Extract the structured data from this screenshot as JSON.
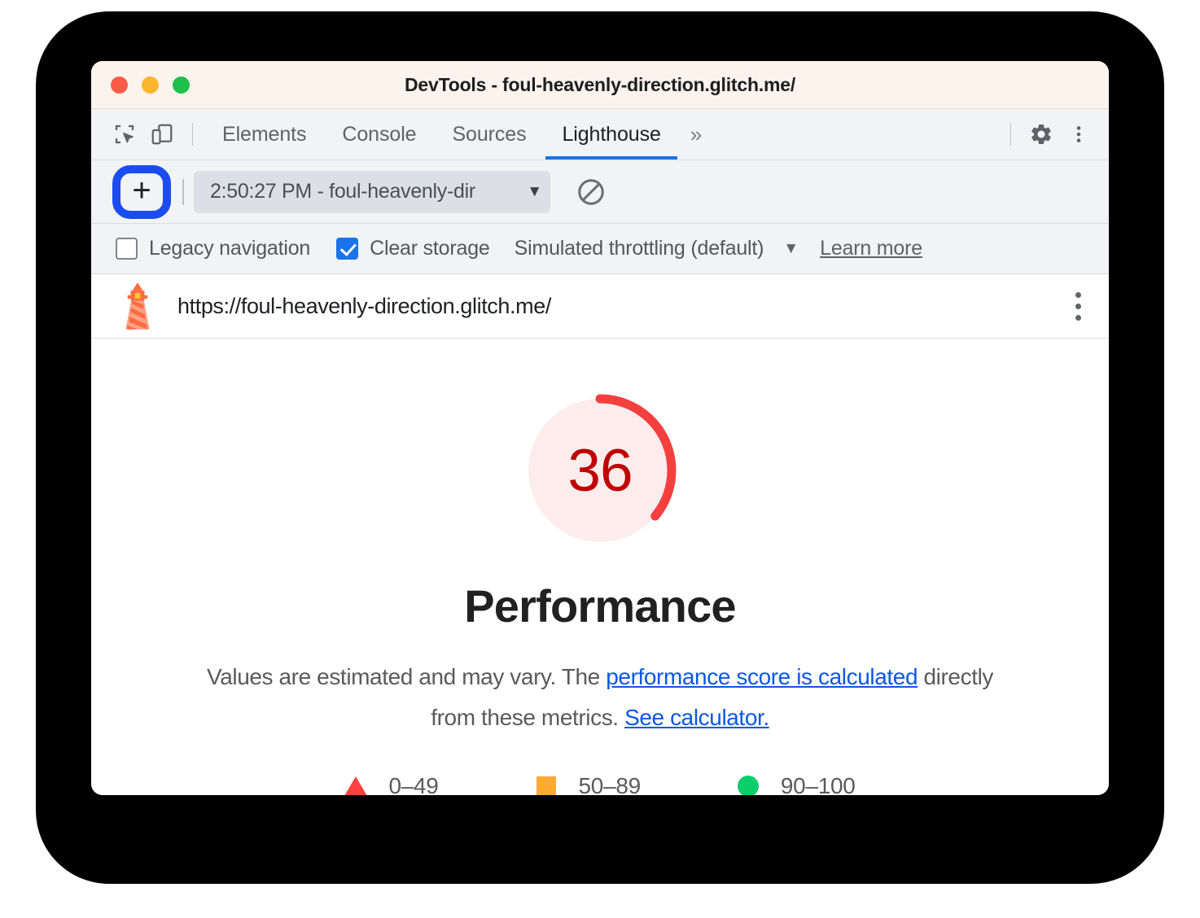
{
  "window": {
    "title": "DevTools - foul-heavenly-direction.glitch.me/",
    "traffic_lights": [
      "close",
      "minimize",
      "zoom"
    ]
  },
  "devtools": {
    "left_icons": [
      {
        "name": "inspect-element-icon",
        "label": "Inspect element"
      },
      {
        "name": "device-toolbar-icon",
        "label": "Toggle device toolbar"
      }
    ],
    "tabs": [
      {
        "label": "Elements",
        "active": false
      },
      {
        "label": "Console",
        "active": false
      },
      {
        "label": "Sources",
        "active": false
      },
      {
        "label": "Lighthouse",
        "active": true
      }
    ],
    "more_tabs_label": "»",
    "right_icons": [
      {
        "name": "settings-gear-icon",
        "label": "Settings"
      },
      {
        "name": "more-options-kebab-icon",
        "label": "Customize and control DevTools"
      }
    ],
    "active_tab_accent": "#1a73e8"
  },
  "lighthouse_toolbar": {
    "add_button_label": "+",
    "add_button_highlight_color": "#1a4cf0",
    "run_select_value": "2:50:27 PM - foul-heavenly-dir",
    "run_select_arrow": "▼",
    "clear_button_name": "clear-all-icon"
  },
  "options": {
    "legacy_navigation": {
      "label": "Legacy navigation",
      "checked": false
    },
    "clear_storage": {
      "label": "Clear storage",
      "checked": true
    },
    "throttling": {
      "label": "Simulated throttling (default)",
      "arrow": "▼"
    },
    "learn_more_label": "Learn more",
    "checkbox_accent": "#1a73e8"
  },
  "report_header": {
    "url": "https://foul-heavenly-direction.glitch.me/",
    "logo_name": "lighthouse-logo-icon",
    "menu_name": "report-options-kebab-icon"
  },
  "report": {
    "category_title": "Performance",
    "disclaimer_prefix": "Values are estimated and may vary. The ",
    "disclaimer_link1": "performance score is calculated",
    "disclaimer_middle": " directly from these metrics. ",
    "disclaimer_link2": "See calculator.",
    "link_color": "#0b57e8"
  },
  "chart_data": {
    "type": "pie",
    "title": "Performance",
    "gauge_score": 36,
    "gauge_max": 100,
    "gauge_percent": 36,
    "gauge_rating": "fail",
    "gauge_arc_color": "#f43f3f",
    "gauge_track_color": "#fdecec",
    "gauge_text_color": "#c00000",
    "legend_position": "bottom",
    "legend": [
      {
        "label": "0–49",
        "shape": "triangle",
        "color": "#ff4040",
        "range": [
          0,
          49
        ]
      },
      {
        "label": "50–89",
        "shape": "square",
        "color": "#ffaa33",
        "range": [
          50,
          89
        ]
      },
      {
        "label": "90–100",
        "shape": "circle",
        "color": "#0bce6b",
        "range": [
          90,
          100
        ]
      }
    ]
  }
}
